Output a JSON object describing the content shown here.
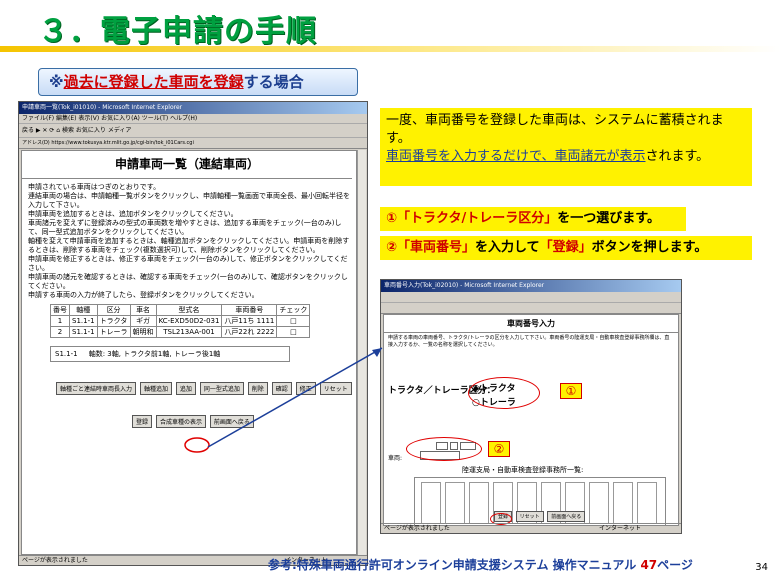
{
  "slide": {
    "title": "３．電子申請の手順",
    "subtitle_prefix": "※",
    "subtitle_highlight": "過去に登録した車両を登録",
    "subtitle_suffix": "する場合",
    "page_number": "34"
  },
  "window1": {
    "title": "申請車両一覧(Tok_i01010) - Microsoft Internet Explorer",
    "menu": "ファイル(F)  編集(E)  表示(V)  お気に入り(A)  ツール(T)  ヘルプ(H)",
    "toolbar": "戻る  ▶  ✕  ⟳  ⌂  検索  お気に入り  メディア",
    "address": "アドレス(D)  https://www.tokusya.ktr.mlit.go.jp/cgi-bin/tok_i01Cars.cgi",
    "heading": "申請車両一覧（連結車両）",
    "intro": [
      "申請されている車両はつぎのとおりです。",
      "連結車両の場合は、申請軸種一覧ボタンをクリックし、申請軸種一覧画面で車両全長、最小回転半径を入力して下さい。",
      "申請車両を追加するときは、追加ボタンをクリックしてください。",
      "車両諸元を変えずに登録済みの型式の車両数を増やすときは、追加する車両をチェック(一台のみ)して、同一型式追加ボタンをクリックしてください。",
      "軸種を変えて申請車両を追加するときは、軸種追加ボタンをクリックしてください。申請車両を削除するときは、削除する車両をチェック(複数選択可)して、削除ボタンをクリックしてください。",
      "申請車両を修正するときは、修正する車両をチェック(一台のみ)して、修正ボタンをクリックしてください。",
      "申請車両の諸元を確認するときは、確認する車両をチェック(一台のみ)して、確認ボタンをクリックしてください。",
      "申請する車両の入力が終了したら、登録ボタンをクリックしてください。"
    ],
    "table_headers": [
      "番号",
      "軸種",
      "区分",
      "車名",
      "型式名",
      "車両番号",
      "チェック"
    ],
    "table_rows": [
      [
        "1",
        "S1.1-1",
        "トラクタ",
        "ギガ",
        "KC-EXD50D2-031",
        "八戸11ち 1111",
        "□"
      ],
      [
        "2",
        "S1.1-1",
        "トレーラ",
        "朝明和",
        "TSL213AA-001",
        "八戸22れ 2222",
        "□"
      ]
    ],
    "axle_code": "S1.1-1",
    "axle_info": "軸数: 3軸, トラクタ前1軸, トレーラ後1軸",
    "buttons": [
      "軸種ごと連結時車両長入力",
      "軸種追加",
      "追加",
      "同一型式追加",
      "削除",
      "確認",
      "修正",
      "リセット"
    ],
    "buttons2": [
      "登録",
      "合成車種の表示",
      "前画面へ戻る"
    ],
    "status": "ページが表示されました",
    "status_zone": "インターネット"
  },
  "instructions": {
    "info_text1": "一度、車両番号を登録した車両は、システムに蓄積されます。",
    "info_link": "車両番号を入力するだけで、車両諸元が表示",
    "info_tail": "されます。",
    "step1_mark": "①",
    "step1_quote": "「トラクタ/トレーラ区分」",
    "step1_rest": "を一つ選びます。",
    "step2_mark": "②",
    "step2_q1": "「車両番号」",
    "step2_mid": "を入力して",
    "step2_q2": "「登録」",
    "step2_rest": "ボタンを押します。"
  },
  "window2": {
    "title": "車両番号入力(Tok_i02010) - Microsoft Internet Explorer",
    "heading": "車両番号入力",
    "intro": "申請する車両の車両番号、トラクタ/トレーラの区分を入力して下さい。車両番号の陸運支局・自動車検査登録事務所欄は、直接入力するか、一覧の名称を選択してください。",
    "kubun_label": "トラクタ／トレーラ区分：",
    "opt_tractor": "トラクタ",
    "opt_trailer": "トレーラ",
    "badge1": "①",
    "badge2": "②",
    "plate_label": "車両:",
    "office_label": "陸運支局・自動車検査登録事務所一覧:",
    "buttons": [
      "登録",
      "リセット",
      "前画面へ戻る"
    ],
    "status": "ページが表示されました",
    "status_zone": "インターネット"
  },
  "reference": {
    "prefix": "参考:特殊車両通行許可オンライン申請支援システム 操作マニュアル ",
    "page": "47",
    "suffix": "ページ"
  }
}
